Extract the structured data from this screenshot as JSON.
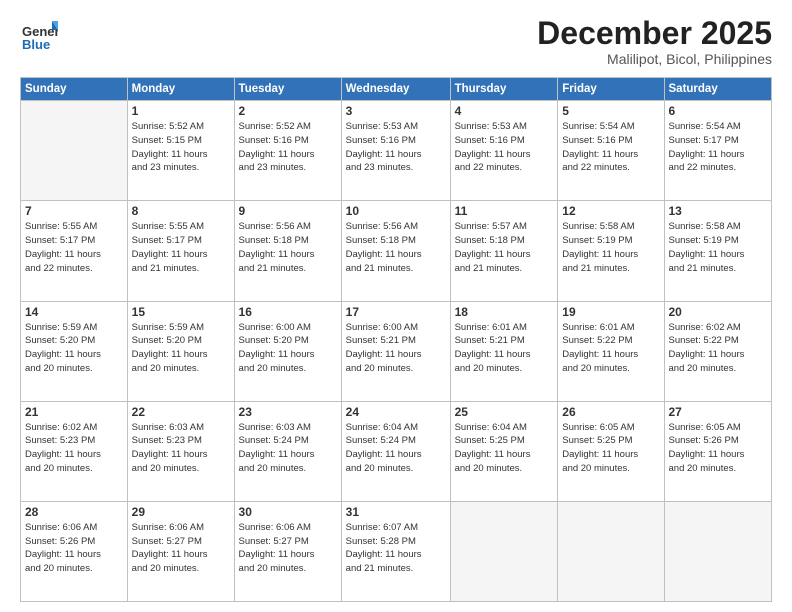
{
  "header": {
    "logo_general": "General",
    "logo_blue": "Blue",
    "month_title": "December 2025",
    "location": "Malilipot, Bicol, Philippines"
  },
  "weekdays": [
    "Sunday",
    "Monday",
    "Tuesday",
    "Wednesday",
    "Thursday",
    "Friday",
    "Saturday"
  ],
  "weeks": [
    [
      {
        "num": "",
        "detail": ""
      },
      {
        "num": "1",
        "detail": "Sunrise: 5:52 AM\nSunset: 5:15 PM\nDaylight: 11 hours\nand 23 minutes."
      },
      {
        "num": "2",
        "detail": "Sunrise: 5:52 AM\nSunset: 5:16 PM\nDaylight: 11 hours\nand 23 minutes."
      },
      {
        "num": "3",
        "detail": "Sunrise: 5:53 AM\nSunset: 5:16 PM\nDaylight: 11 hours\nand 23 minutes."
      },
      {
        "num": "4",
        "detail": "Sunrise: 5:53 AM\nSunset: 5:16 PM\nDaylight: 11 hours\nand 22 minutes."
      },
      {
        "num": "5",
        "detail": "Sunrise: 5:54 AM\nSunset: 5:16 PM\nDaylight: 11 hours\nand 22 minutes."
      },
      {
        "num": "6",
        "detail": "Sunrise: 5:54 AM\nSunset: 5:17 PM\nDaylight: 11 hours\nand 22 minutes."
      }
    ],
    [
      {
        "num": "7",
        "detail": "Sunrise: 5:55 AM\nSunset: 5:17 PM\nDaylight: 11 hours\nand 22 minutes."
      },
      {
        "num": "8",
        "detail": "Sunrise: 5:55 AM\nSunset: 5:17 PM\nDaylight: 11 hours\nand 21 minutes."
      },
      {
        "num": "9",
        "detail": "Sunrise: 5:56 AM\nSunset: 5:18 PM\nDaylight: 11 hours\nand 21 minutes."
      },
      {
        "num": "10",
        "detail": "Sunrise: 5:56 AM\nSunset: 5:18 PM\nDaylight: 11 hours\nand 21 minutes."
      },
      {
        "num": "11",
        "detail": "Sunrise: 5:57 AM\nSunset: 5:18 PM\nDaylight: 11 hours\nand 21 minutes."
      },
      {
        "num": "12",
        "detail": "Sunrise: 5:58 AM\nSunset: 5:19 PM\nDaylight: 11 hours\nand 21 minutes."
      },
      {
        "num": "13",
        "detail": "Sunrise: 5:58 AM\nSunset: 5:19 PM\nDaylight: 11 hours\nand 21 minutes."
      }
    ],
    [
      {
        "num": "14",
        "detail": "Sunrise: 5:59 AM\nSunset: 5:20 PM\nDaylight: 11 hours\nand 20 minutes."
      },
      {
        "num": "15",
        "detail": "Sunrise: 5:59 AM\nSunset: 5:20 PM\nDaylight: 11 hours\nand 20 minutes."
      },
      {
        "num": "16",
        "detail": "Sunrise: 6:00 AM\nSunset: 5:20 PM\nDaylight: 11 hours\nand 20 minutes."
      },
      {
        "num": "17",
        "detail": "Sunrise: 6:00 AM\nSunset: 5:21 PM\nDaylight: 11 hours\nand 20 minutes."
      },
      {
        "num": "18",
        "detail": "Sunrise: 6:01 AM\nSunset: 5:21 PM\nDaylight: 11 hours\nand 20 minutes."
      },
      {
        "num": "19",
        "detail": "Sunrise: 6:01 AM\nSunset: 5:22 PM\nDaylight: 11 hours\nand 20 minutes."
      },
      {
        "num": "20",
        "detail": "Sunrise: 6:02 AM\nSunset: 5:22 PM\nDaylight: 11 hours\nand 20 minutes."
      }
    ],
    [
      {
        "num": "21",
        "detail": "Sunrise: 6:02 AM\nSunset: 5:23 PM\nDaylight: 11 hours\nand 20 minutes."
      },
      {
        "num": "22",
        "detail": "Sunrise: 6:03 AM\nSunset: 5:23 PM\nDaylight: 11 hours\nand 20 minutes."
      },
      {
        "num": "23",
        "detail": "Sunrise: 6:03 AM\nSunset: 5:24 PM\nDaylight: 11 hours\nand 20 minutes."
      },
      {
        "num": "24",
        "detail": "Sunrise: 6:04 AM\nSunset: 5:24 PM\nDaylight: 11 hours\nand 20 minutes."
      },
      {
        "num": "25",
        "detail": "Sunrise: 6:04 AM\nSunset: 5:25 PM\nDaylight: 11 hours\nand 20 minutes."
      },
      {
        "num": "26",
        "detail": "Sunrise: 6:05 AM\nSunset: 5:25 PM\nDaylight: 11 hours\nand 20 minutes."
      },
      {
        "num": "27",
        "detail": "Sunrise: 6:05 AM\nSunset: 5:26 PM\nDaylight: 11 hours\nand 20 minutes."
      }
    ],
    [
      {
        "num": "28",
        "detail": "Sunrise: 6:06 AM\nSunset: 5:26 PM\nDaylight: 11 hours\nand 20 minutes."
      },
      {
        "num": "29",
        "detail": "Sunrise: 6:06 AM\nSunset: 5:27 PM\nDaylight: 11 hours\nand 20 minutes."
      },
      {
        "num": "30",
        "detail": "Sunrise: 6:06 AM\nSunset: 5:27 PM\nDaylight: 11 hours\nand 20 minutes."
      },
      {
        "num": "31",
        "detail": "Sunrise: 6:07 AM\nSunset: 5:28 PM\nDaylight: 11 hours\nand 21 minutes."
      },
      {
        "num": "",
        "detail": ""
      },
      {
        "num": "",
        "detail": ""
      },
      {
        "num": "",
        "detail": ""
      }
    ]
  ]
}
